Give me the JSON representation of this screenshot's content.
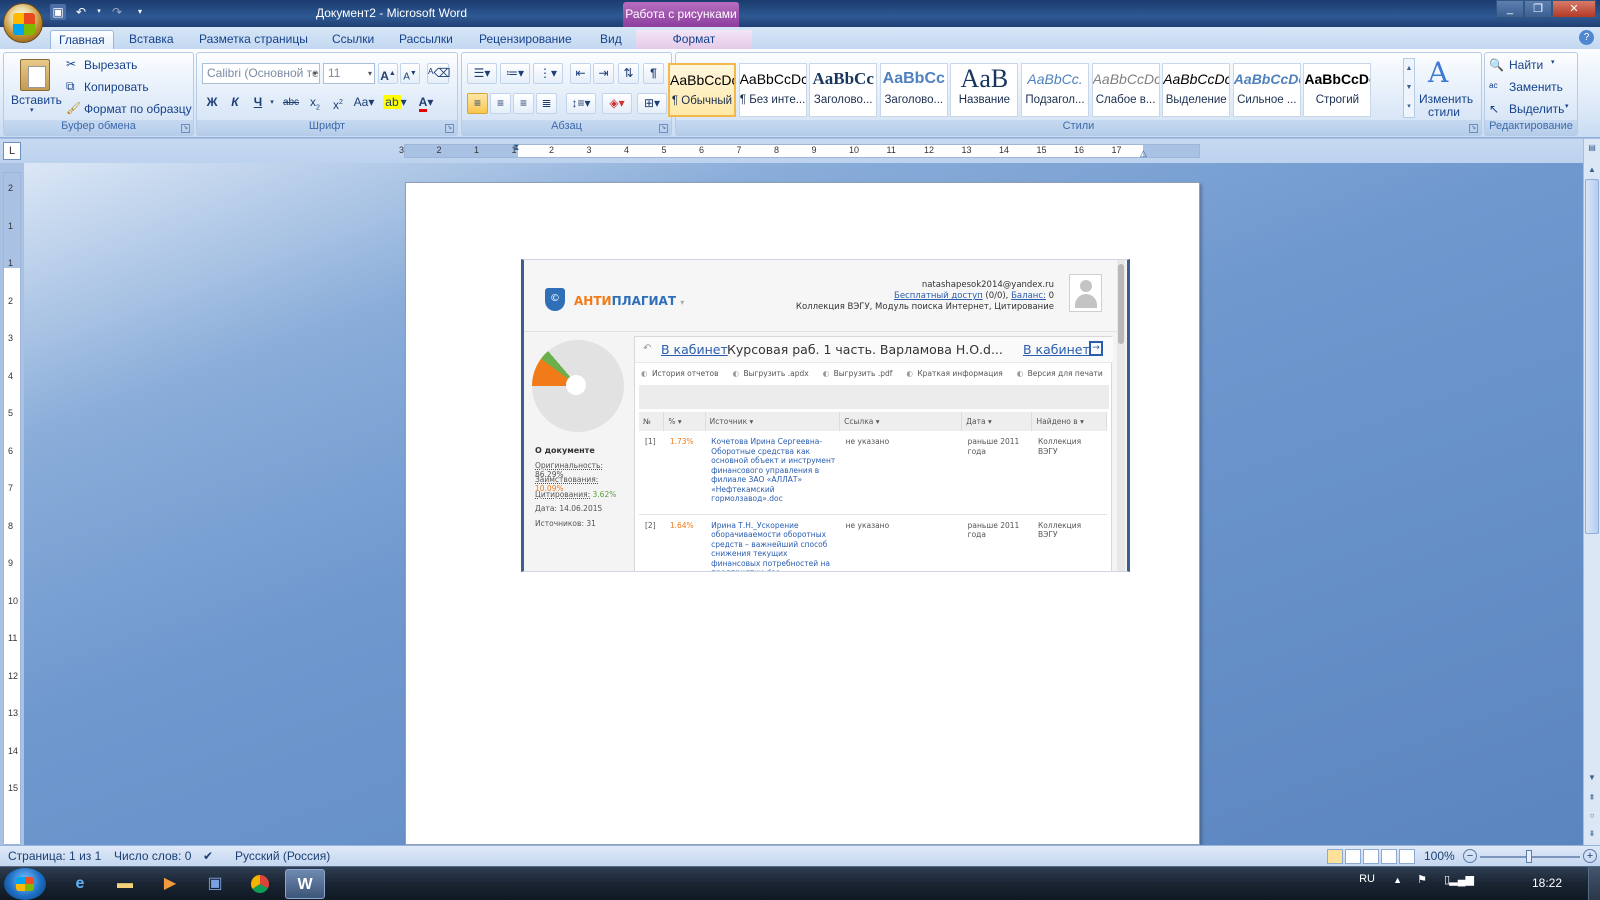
{
  "window": {
    "title": "Документ2 - Microsoft Word",
    "context_tab_title": "Работа с рисунками"
  },
  "tabs": [
    "Главная",
    "Вставка",
    "Разметка страницы",
    "Ссылки",
    "Рассылки",
    "Рецензирование",
    "Вид",
    "Формат"
  ],
  "clipboard": {
    "paste": "Вставить",
    "cut": "Вырезать",
    "copy": "Копировать",
    "format_painter": "Формат по образцу",
    "label": "Буфер обмена"
  },
  "font": {
    "name": "Calibri (Основной те",
    "size": "11",
    "label": "Шрифт",
    "bold": "Ж",
    "italic": "К",
    "underline": "Ч"
  },
  "paragraph": {
    "label": "Абзац"
  },
  "styles": {
    "label": "Стили",
    "change_styles": "Изменить стили",
    "items": [
      {
        "sample": "AaBbCcDc",
        "name": "¶ Обычный"
      },
      {
        "sample": "AaBbCcDc",
        "name": "¶ Без инте..."
      },
      {
        "sample": "AaBbCc",
        "name": "Заголово..."
      },
      {
        "sample": "AaBbCc",
        "name": "Заголово..."
      },
      {
        "sample": "AaB",
        "name": "Название"
      },
      {
        "sample": "AaBbCc.",
        "name": "Подзагол..."
      },
      {
        "sample": "AaBbCcDc",
        "name": "Слабое в..."
      },
      {
        "sample": "AaBbCcDc",
        "name": "Выделение"
      },
      {
        "sample": "AaBbCcDc",
        "name": "Сильное ..."
      },
      {
        "sample": "AaBbCcDc",
        "name": "Строгий"
      }
    ]
  },
  "editing": {
    "find": "Найти",
    "replace": "Заменить",
    "select": "Выделить",
    "label": "Редактирование"
  },
  "hruler_numbers": [
    "3",
    "2",
    "1",
    "1",
    "2",
    "3",
    "4",
    "5",
    "6",
    "7",
    "8",
    "9",
    "10",
    "11",
    "12",
    "13",
    "14",
    "15",
    "16",
    "17"
  ],
  "vruler_numbers": [
    "2",
    "1",
    "1",
    "2",
    "3",
    "4",
    "5",
    "6",
    "7",
    "8",
    "9",
    "10",
    "11",
    "12",
    "13",
    "14",
    "15"
  ],
  "antiplagiat": {
    "brand_a": "АНТИ",
    "brand_b": "ПЛАГИАТ",
    "email": "natashapesok2014@yandex.ru",
    "access_link": "Бесплатный доступ",
    "access_rest": " (0/0), ",
    "balance_link": "Баланс:",
    "balance_val": " 0",
    "collection": "Коллекция ВЭГУ, Модуль поиска Интернет, Цитирование",
    "doc_section": "О документе",
    "originality_label": "Оригинальность:",
    "originality_val": "86.29%",
    "borrowing_label": "Заимствования:",
    "borrowing_val": "10.09%",
    "citation_label": "Цитирования:",
    "citation_val": "3.62%",
    "date": "Дата: 14.06.2015",
    "sources_count": "Источников: 31",
    "cabinet_left": "В кабинет",
    "doc_name": "Курсовая раб. 1 часть. Варламова Н.О.d...",
    "cabinet_right": "В кабинет",
    "tools": [
      "История отчетов",
      "Выгрузить .apdx",
      "Выгрузить .pdf",
      "Краткая информация",
      "Версия для печати"
    ],
    "columns": [
      "№",
      "%",
      "Источник",
      "Ссылка",
      "Дата",
      "Найдено в"
    ],
    "rows": [
      {
        "n": "[1]",
        "pct": "1.73%",
        "source": "Кочетова Ирина Сергеевна- Оборотные средства как основной объект и инструмент финансового управления в филиале ЗАО «АЛЛАТ» «Нефтекамский гормолзавод».doc",
        "link": "не указано",
        "date": "раньше 2011 года",
        "found": "Коллекция ВЭГУ"
      },
      {
        "n": "[2]",
        "pct": "1.64%",
        "source": "Ирина Т.Н._Ускорение оборачиваемости оборотных средств – важнейший способ снижения текущих финансовых потребностей на предприятии.doc",
        "link": "не указано",
        "date": "раньше 2011 года",
        "found": "Коллекция ВЭГУ"
      }
    ]
  },
  "status": {
    "page": "Страница: 1 из 1",
    "words": "Число слов: 0",
    "lang": "Русский (Россия)",
    "zoom": "100%"
  },
  "taskbar": {
    "lang": "RU",
    "time": "18:22"
  }
}
